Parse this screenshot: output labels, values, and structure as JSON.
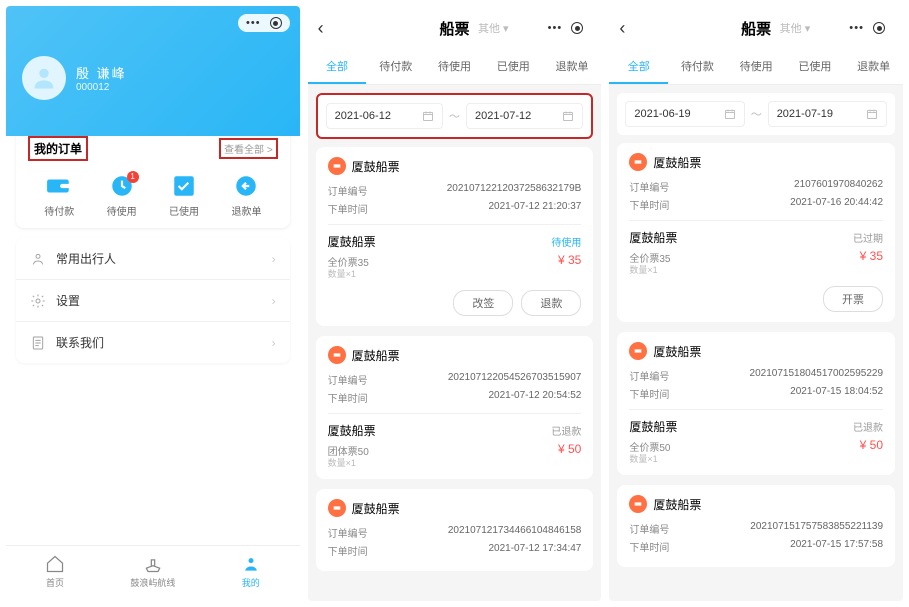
{
  "screen1": {
    "user": {
      "name": "殷 谦峰",
      "id": "000012"
    },
    "orders": {
      "title": "我的订单",
      "more": "查看全部 >"
    },
    "tabs": [
      {
        "icon": "wallet",
        "label": "待付款",
        "badge": null
      },
      {
        "icon": "clock",
        "label": "待使用",
        "badge": "1"
      },
      {
        "icon": "check",
        "label": "已使用",
        "badge": null
      },
      {
        "icon": "refund",
        "label": "退款单",
        "badge": null
      }
    ],
    "menu": [
      {
        "icon": "person",
        "label": "常用出行人"
      },
      {
        "icon": "gear",
        "label": "设置"
      },
      {
        "icon": "note",
        "label": "联系我们"
      }
    ],
    "bottomNav": [
      {
        "label": "首页"
      },
      {
        "label": "鼓浪屿航线"
      },
      {
        "label": "我的"
      }
    ]
  },
  "screen2": {
    "title": "船票",
    "other": "其他 ▾",
    "tabs": [
      "全部",
      "待付款",
      "待使用",
      "已使用",
      "退款单"
    ],
    "dateFrom": "2021-06-12",
    "dateTo": "2021-07-12",
    "orders": [
      {
        "company": "厦鼓船票",
        "orderNo": "20210712212037258632179B",
        "orderTime": "2021-07-12 21:20:37",
        "route": "厦鼓船票",
        "status": "待使用",
        "statusCls": "st-wait",
        "fare": "全价票35",
        "price": "¥ 35",
        "qty": "数量×1",
        "buttons": [
          "改签",
          "退款"
        ]
      },
      {
        "company": "厦鼓船票",
        "orderNo": "202107122054526703515907",
        "orderTime": "2021-07-12 20:54:52",
        "route": "厦鼓船票",
        "status": "已退款",
        "statusCls": "st-ref",
        "fare": "团体票50",
        "price": "¥ 50",
        "qty": "数量×1",
        "buttons": []
      },
      {
        "company": "厦鼓船票",
        "orderNo": "202107121734466104846158",
        "orderTime": "2021-07-12 17:34:47",
        "route": "",
        "status": "",
        "statusCls": "",
        "fare": "",
        "price": "",
        "qty": "",
        "buttons": []
      }
    ]
  },
  "screen3": {
    "title": "船票",
    "other": "其他 ▾",
    "tabs": [
      "全部",
      "待付款",
      "待使用",
      "已使用",
      "退款单"
    ],
    "dateFrom": "2021-06-19",
    "dateTo": "2021-07-19",
    "orders": [
      {
        "company": "厦鼓船票",
        "orderNo": "2107601970840262",
        "orderTime": "2021-07-16 20:44:42",
        "route": "厦鼓船票",
        "status": "已过期",
        "statusCls": "st-exp",
        "fare": "全价票35",
        "price": "¥ 35",
        "qty": "数量×1",
        "buttons": [
          "开票"
        ]
      },
      {
        "company": "厦鼓船票",
        "orderNo": "202107151804517002595229",
        "orderTime": "2021-07-15 18:04:52",
        "route": "厦鼓船票",
        "status": "已退款",
        "statusCls": "st-ref",
        "fare": "全价票50",
        "price": "¥ 50",
        "qty": "数量×1",
        "buttons": []
      },
      {
        "company": "厦鼓船票",
        "orderNo": "202107151757583855221139",
        "orderTime": "2021-07-15 17:57:58",
        "route": "",
        "status": "",
        "statusCls": "",
        "fare": "",
        "price": "",
        "qty": "",
        "buttons": []
      }
    ]
  },
  "labels": {
    "orderNo": "订单编号",
    "orderTime": "下单时间"
  }
}
